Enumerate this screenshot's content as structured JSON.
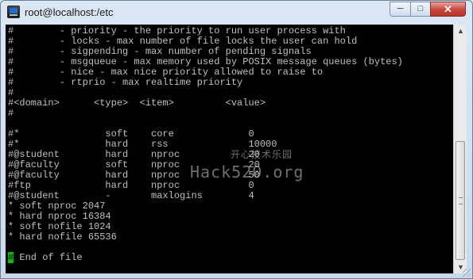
{
  "window": {
    "title": "root@localhost:/etc",
    "app_icon": "putty-terminal-icon",
    "controls": {
      "minimize": "─",
      "maximize": "□",
      "close": "✕"
    }
  },
  "terminal": {
    "lines": [
      "#        - priority - the priority to run user process with",
      "#        - locks - max number of file locks the user can hold",
      "#        - sigpending - max number of pending signals",
      "#        - msgqueue - max memory used by POSIX message queues (bytes)",
      "#        - nice - max nice priority allowed to raise to",
      "#        - rtprio - max realtime priority",
      "#",
      "#<domain>      <type>  <item>         <value>",
      "#",
      "",
      "#*               soft    core             0",
      "#*               hard    rss              10000",
      "#@student        hard    nproc            20",
      "#@faculty        soft    nproc            20",
      "#@faculty        hard    nproc            50",
      "#ftp             hard    nproc            0",
      "#@student        -       maxlogins        4",
      "* soft nproc 2047",
      "* hard nproc 16384",
      "* soft nofile 1024",
      "* hard nofile 65536",
      "",
      ""
    ],
    "last_line_cursor": "#",
    "last_line_text": " End of file"
  },
  "watermark": {
    "chinese": "开心技术乐园",
    "site": "Hack520.org"
  },
  "scrollbar": {
    "up_arrow": "▲",
    "down_arrow": "▼"
  }
}
